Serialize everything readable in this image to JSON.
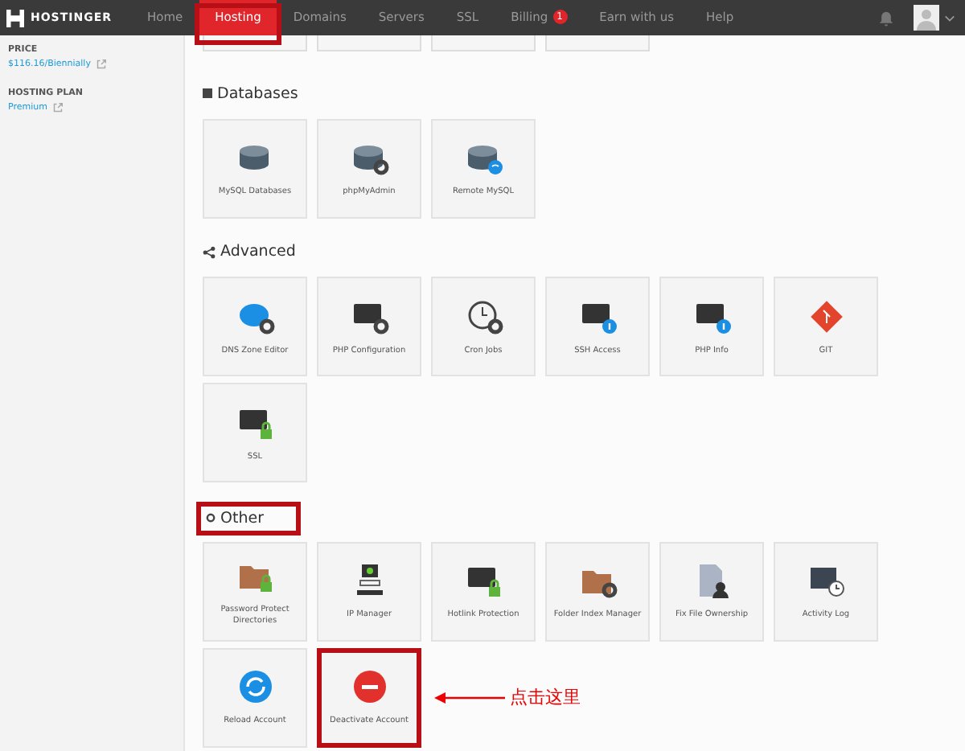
{
  "nav": {
    "brand": "HOSTINGER",
    "items": [
      {
        "label": "Home",
        "selected": false,
        "highlighted": false
      },
      {
        "label": "Hosting",
        "selected": true,
        "highlighted": true
      },
      {
        "label": "Domains",
        "selected": false,
        "highlighted": false
      },
      {
        "label": "Servers",
        "selected": false,
        "highlighted": false
      },
      {
        "label": "SSL",
        "selected": false,
        "highlighted": false
      },
      {
        "label": "Billing",
        "selected": false,
        "highlighted": false,
        "badge": "1"
      },
      {
        "label": "Earn with us",
        "selected": false,
        "highlighted": false
      },
      {
        "label": "Help",
        "selected": false,
        "highlighted": false
      }
    ]
  },
  "sidebar": [
    {
      "label": "PRICE",
      "value": "$116.16/Biennially"
    },
    {
      "label": "HOSTING PLAN",
      "value": "Premium"
    }
  ],
  "sections": [
    {
      "title": "Databases",
      "kind": "db",
      "highlighted": false,
      "tiles": [
        {
          "label": "MySQL Databases",
          "kind": "db",
          "highlighted": false
        },
        {
          "label": "phpMyAdmin",
          "kind": "db-gear",
          "highlighted": false
        },
        {
          "label": "Remote MySQL",
          "kind": "db-wifi",
          "highlighted": false
        }
      ]
    },
    {
      "title": "Advanced",
      "kind": "share",
      "highlighted": false,
      "tiles": [
        {
          "label": "DNS Zone Editor",
          "kind": "dns",
          "highlighted": false
        },
        {
          "label": "PHP Configuration",
          "kind": "php-gear",
          "highlighted": false
        },
        {
          "label": "Cron Jobs",
          "kind": "clock-gear",
          "highlighted": false
        },
        {
          "label": "SSH Access",
          "kind": "terminal-info",
          "highlighted": false
        },
        {
          "label": "PHP Info",
          "kind": "php-info",
          "highlighted": false
        },
        {
          "label": "GIT",
          "kind": "git",
          "highlighted": false
        },
        {
          "label": "SSL",
          "kind": "ssl",
          "highlighted": false
        }
      ]
    },
    {
      "title": "Other",
      "kind": "gear",
      "highlighted": true,
      "tiles": [
        {
          "label": "Password Protect Directories",
          "kind": "folder-lock",
          "highlighted": false
        },
        {
          "label": "IP Manager",
          "kind": "ip",
          "highlighted": false
        },
        {
          "label": "Hotlink Protection",
          "kind": "screen-lock",
          "highlighted": false
        },
        {
          "label": "Folder Index Manager",
          "kind": "folder-gear",
          "highlighted": false
        },
        {
          "label": "Fix File Ownership",
          "kind": "file-user",
          "highlighted": false
        },
        {
          "label": "Activity Log",
          "kind": "log",
          "highlighted": false
        },
        {
          "label": "Reload Account",
          "kind": "reload",
          "highlighted": false
        },
        {
          "label": "Deactivate Account",
          "kind": "minus",
          "highlighted": true
        }
      ]
    }
  ],
  "callout": {
    "text": "点击这里"
  }
}
